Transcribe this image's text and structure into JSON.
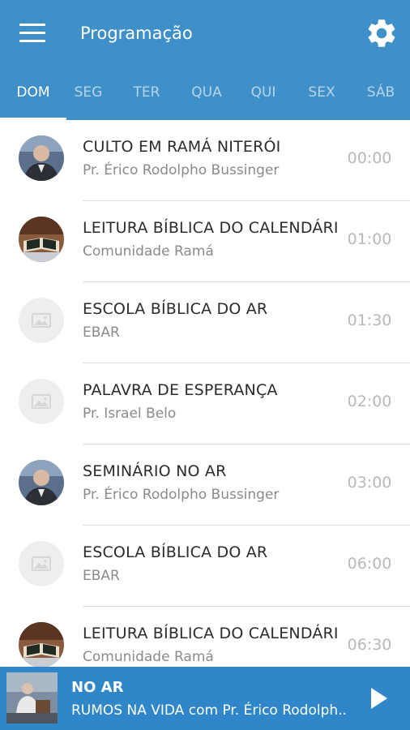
{
  "header": {
    "title": "Programação",
    "menu_icon": "hamburger-menu-icon",
    "settings_icon": "gear-icon",
    "background_color": "#3f8fc8"
  },
  "tabs": [
    {
      "label": "DOM",
      "active": true
    },
    {
      "label": "SEG",
      "active": false
    },
    {
      "label": "TER",
      "active": false
    },
    {
      "label": "QUA",
      "active": false
    },
    {
      "label": "QUI",
      "active": false
    },
    {
      "label": "SEX",
      "active": false
    },
    {
      "label": "SÁB",
      "active": false
    }
  ],
  "schedule": [
    {
      "title": "CULTO EM RAMÁ NITERÓI",
      "host": "Pr. Érico Rodolpho Bussinger",
      "time": "00:00",
      "avatar": "pastor-photo"
    },
    {
      "title": "LEITURA BÍBLICA DO CALENDÁRIO",
      "host": "Comunidade Ramá",
      "time": "01:00",
      "avatar": "bible-photo"
    },
    {
      "title": "ESCOLA BÍBLICA DO AR",
      "host": "EBAR",
      "time": "01:30",
      "avatar": "image-placeholder-icon"
    },
    {
      "title": "PALAVRA DE ESPERANÇA",
      "host": "Pr. Israel Belo",
      "time": "02:00",
      "avatar": "image-placeholder-icon"
    },
    {
      "title": "SEMINÁRIO NO AR",
      "host": "Pr. Érico Rodolpho Bussinger",
      "time": "03:00",
      "avatar": "pastor-photo"
    },
    {
      "title": "ESCOLA BÍBLICA DO AR",
      "host": "EBAR",
      "time": "06:00",
      "avatar": "image-placeholder-icon"
    },
    {
      "title": "LEITURA BÍBLICA DO CALENDÁRIO",
      "host": "Comunidade Ramá",
      "time": "06:30",
      "avatar": "bible-photo"
    }
  ],
  "player": {
    "status": "NO AR",
    "program": "RUMOS NA VIDA com Pr. Érico Rodolpho Bussinger",
    "play_icon": "play-icon",
    "background_color": "#2f86c8"
  }
}
